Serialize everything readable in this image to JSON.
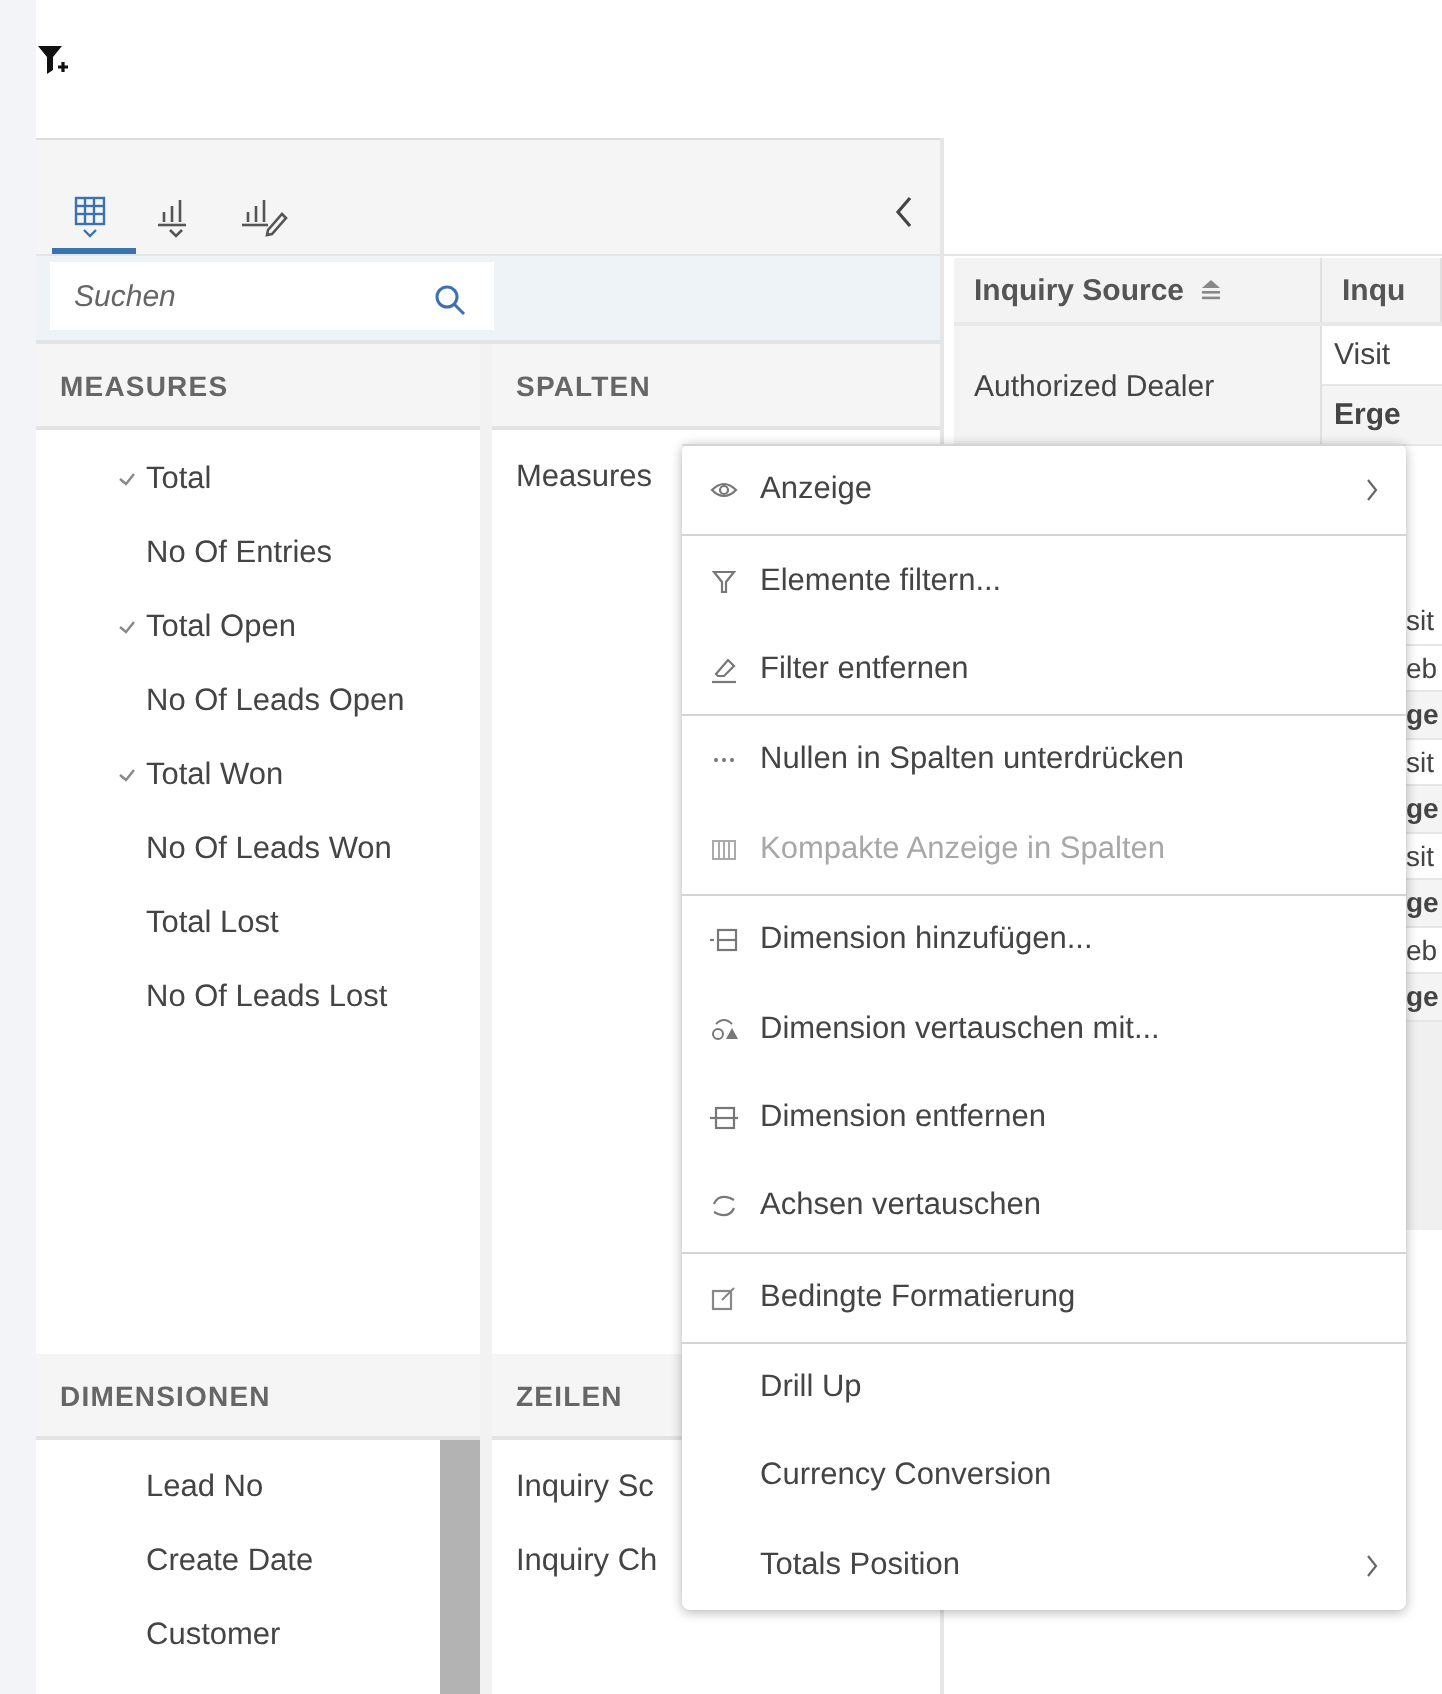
{
  "toolbar": {
    "tabs": [
      {
        "kind": "table",
        "selected": true
      },
      {
        "kind": "chart",
        "selected": false
      },
      {
        "kind": "chart-edit",
        "selected": false
      }
    ]
  },
  "search": {
    "placeholder": "Suchen"
  },
  "measures": {
    "title": "MEASURES",
    "items": [
      {
        "label": "Total",
        "checked": true
      },
      {
        "label": "No Of Entries",
        "checked": false
      },
      {
        "label": "Total Open",
        "checked": true
      },
      {
        "label": "No Of Leads Open",
        "checked": false
      },
      {
        "label": "Total Won",
        "checked": true
      },
      {
        "label": "No Of Leads Won",
        "checked": false
      },
      {
        "label": "Total Lost",
        "checked": false
      },
      {
        "label": "No Of Leads Lost",
        "checked": false
      }
    ]
  },
  "columns_area": {
    "title": "SPALTEN",
    "items": [
      "Measures"
    ]
  },
  "dimensions": {
    "title": "DIMENSIONEN",
    "items": [
      "Lead No",
      "Create Date",
      "Customer"
    ]
  },
  "rows_area": {
    "title": "ZEILEN",
    "items": [
      "Inquiry Sc",
      "Inquiry Ch"
    ]
  },
  "table": {
    "columns": [
      {
        "label": "Inquiry Source",
        "sorted": true
      },
      {
        "label": "Inqu",
        "sorted": false
      }
    ],
    "row_header": "Authorized Dealer",
    "column_2_cells": [
      {
        "text": "Visit",
        "total": false
      },
      {
        "text": "Erge",
        "total": true
      }
    ],
    "column_3_cells": [
      {
        "text": "sit",
        "total": false
      },
      {
        "text": "eb",
        "total": false
      },
      {
        "text": "ge",
        "total": true
      },
      {
        "text": "sit",
        "total": false
      },
      {
        "text": "ge",
        "total": true
      },
      {
        "text": "sit",
        "total": false
      },
      {
        "text": "ge",
        "total": true
      },
      {
        "text": "eb",
        "total": false
      },
      {
        "text": "ge",
        "total": true
      }
    ]
  },
  "context_menu": {
    "groups": [
      [
        {
          "label": "Anzeige",
          "kind": "eye",
          "disabled": false,
          "submenu": true
        }
      ],
      [
        {
          "label": "Elemente filtern...",
          "kind": "filter",
          "disabled": false,
          "submenu": false
        },
        {
          "label": "Filter entfernen",
          "kind": "eraser",
          "disabled": false,
          "submenu": false
        }
      ],
      [
        {
          "label": "Nullen in Spalten unterdrücken",
          "kind": "dots",
          "disabled": false,
          "submenu": false
        },
        {
          "label": "Kompakte Anzeige in Spalten",
          "kind": "columns",
          "disabled": true,
          "submenu": false
        }
      ],
      [
        {
          "label": "Dimension hinzufügen...",
          "kind": "add-dimension",
          "disabled": false,
          "submenu": false
        },
        {
          "label": "Dimension vertauschen mit...",
          "kind": "swap-dimension",
          "disabled": false,
          "submenu": false
        },
        {
          "label": "Dimension entfernen",
          "kind": "remove-dimension",
          "disabled": false,
          "submenu": false
        },
        {
          "label": "Achsen vertauschen",
          "kind": "swap-axes",
          "disabled": false,
          "submenu": false
        }
      ],
      [
        {
          "label": "Bedingte Formatierung",
          "kind": "format",
          "disabled": false,
          "submenu": false
        }
      ],
      [
        {
          "label": "Drill Up",
          "kind": "plain",
          "disabled": false,
          "submenu": false
        },
        {
          "label": "Currency Conversion",
          "kind": "plain",
          "disabled": false,
          "submenu": false
        },
        {
          "label": "Totals Position",
          "kind": "plain",
          "disabled": false,
          "submenu": true
        }
      ]
    ]
  }
}
